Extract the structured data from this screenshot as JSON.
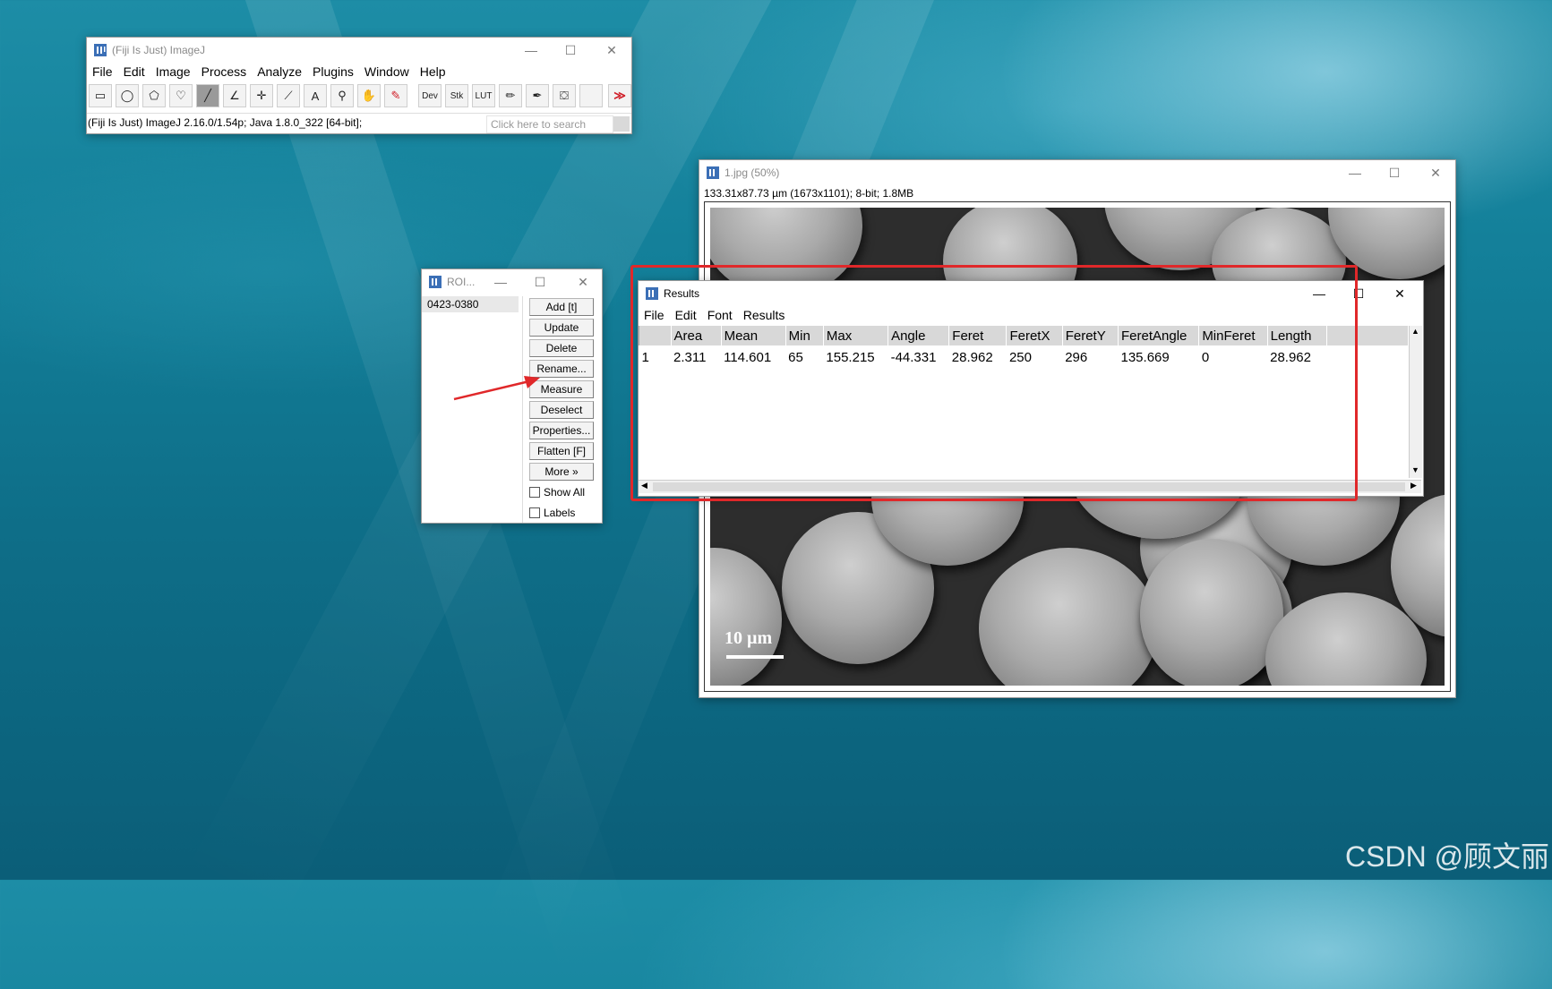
{
  "main_window": {
    "title": "(Fiji Is Just) ImageJ",
    "menu": [
      "File",
      "Edit",
      "Image",
      "Process",
      "Analyze",
      "Plugins",
      "Window",
      "Help"
    ],
    "tools": [
      {
        "name": "rectangle-tool-icon",
        "glyph": "▭"
      },
      {
        "name": "oval-tool-icon",
        "glyph": "◯"
      },
      {
        "name": "polygon-tool-icon",
        "glyph": "⬠"
      },
      {
        "name": "freehand-tool-icon",
        "glyph": "♡"
      },
      {
        "name": "line-tool-icon",
        "glyph": "╱"
      },
      {
        "name": "angle-tool-icon",
        "glyph": "∠"
      },
      {
        "name": "point-tool-icon",
        "glyph": "✛"
      },
      {
        "name": "wand-tool-icon",
        "glyph": "⟋"
      },
      {
        "name": "text-tool-icon",
        "glyph": "A"
      },
      {
        "name": "magnifier-tool-icon",
        "glyph": "⚲"
      },
      {
        "name": "hand-tool-icon",
        "glyph": "✋"
      },
      {
        "name": "color-picker-tool-icon",
        "glyph": "✎"
      },
      {
        "name": "dev-menu-icon",
        "glyph": "Dev"
      },
      {
        "name": "stk-menu-icon",
        "glyph": "Stk"
      },
      {
        "name": "lut-menu-icon",
        "glyph": "LUT"
      },
      {
        "name": "pencil-tool-icon",
        "glyph": "✏"
      },
      {
        "name": "brush-tool-icon",
        "glyph": "✒"
      },
      {
        "name": "flood-fill-tool-icon",
        "glyph": "⛋"
      },
      {
        "name": "blank-tool-icon",
        "glyph": ""
      },
      {
        "name": "more-tools-icon",
        "glyph": "≫"
      }
    ],
    "status": "(Fiji Is Just) ImageJ 2.16.0/1.54p; Java 1.8.0_322 [64-bit];",
    "search_placeholder": "Click here to search"
  },
  "roi_window": {
    "title": "ROI...",
    "list": [
      "0423-0380"
    ],
    "buttons": [
      "Add [t]",
      "Update",
      "Delete",
      "Rename...",
      "Measure",
      "Deselect",
      "Properties...",
      "Flatten [F]",
      "More »"
    ],
    "checkboxes": [
      "Show All",
      "Labels"
    ]
  },
  "image_window": {
    "title": "1.jpg (50%)",
    "info": "133.31x87.73 µm (1673x1101); 8-bit; 1.8MB",
    "scale_bar_label": "10 µm"
  },
  "results_window": {
    "title": "Results",
    "menu": [
      "File",
      "Edit",
      "Font",
      "Results"
    ],
    "columns": [
      "",
      "Area",
      "Mean",
      "Min",
      "Max",
      "Angle",
      "Feret",
      "FeretX",
      "FeretY",
      "FeretAngle",
      "MinFeret",
      "Length"
    ],
    "rows": [
      [
        "1",
        "2.311",
        "114.601",
        "65",
        "155.215",
        "-44.331",
        "28.962",
        "250",
        "296",
        "135.669",
        "0",
        "28.962"
      ]
    ]
  },
  "watermark": "CSDN @顾文丽",
  "colors": {
    "highlight_box": "#e0282a",
    "arrow": "#e0282a",
    "window_bg": "#ffffff"
  }
}
